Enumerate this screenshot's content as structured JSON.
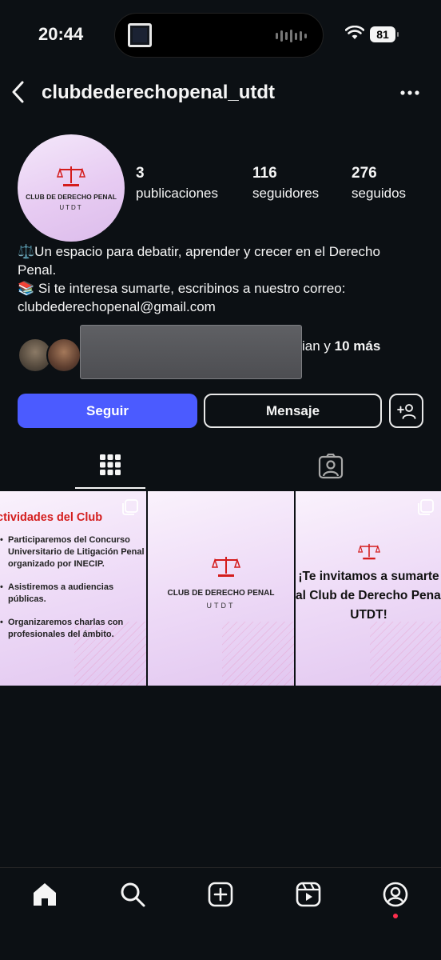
{
  "status_bar": {
    "time": "20:44",
    "battery": "81"
  },
  "header": {
    "username": "clubdederechopenal_utdt"
  },
  "profile": {
    "avatar": {
      "line1": "CLUB DE DERECHO PENAL",
      "line2": "UTDT"
    },
    "stats": {
      "posts": {
        "count": "3",
        "label": "publicaciones"
      },
      "followers": {
        "count": "116",
        "label": "seguidores"
      },
      "following": {
        "count": "276",
        "label": "seguidos"
      }
    },
    "bio": [
      "⚖️Un espacio para debatir, aprender y crecer en el Derecho",
      "Penal.",
      "📚 Si te interesa sumarte, escribinos a nuestro correo:",
      "clubdederechopenal@gmail.com"
    ],
    "followed_by": {
      "visible_suffix": "ian y",
      "more": "10 más"
    }
  },
  "buttons": {
    "follow": "Seguir",
    "message": "Mensaje"
  },
  "tabs": [
    {
      "name": "grid",
      "icon": "grid-icon",
      "active": true
    },
    {
      "name": "tagged",
      "icon": "tagged-icon",
      "active": false
    }
  ],
  "posts": [
    {
      "title": "ctividades del Club",
      "items": [
        "Participaremos del Concurso Universitario de Litigación Penal organizado por INECIP.",
        "Asistiremos a audiencias públicas.",
        "Organizaremos charlas con profesionales del ámbito."
      ]
    },
    {
      "line1": "CLUB DE DERECHO PENAL",
      "line2": "UTDT"
    },
    {
      "lines": [
        "¡Te invitamos a sumarte",
        "al Club de Derecho Penal",
        "UTDT!"
      ]
    }
  ],
  "bottom_nav": [
    "home-icon",
    "search-icon",
    "create-icon",
    "reels-icon",
    "profile-icon"
  ],
  "colors": {
    "background": "#0c1014",
    "follow_button": "#4b5bff",
    "logo_red": "#d41d1d",
    "notification_dot": "#ff2e4d"
  }
}
